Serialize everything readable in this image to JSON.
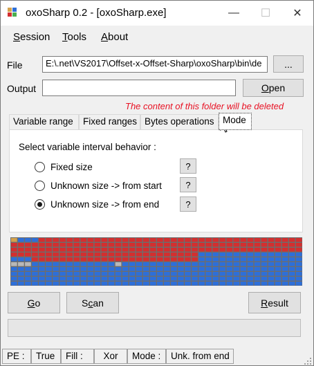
{
  "window": {
    "title": "oxoSharp 0.2 - [oxoSharp.exe]",
    "minimize_glyph": "—",
    "maximize_glyph": "☐",
    "close_glyph": "✕"
  },
  "menu": [
    {
      "u": "S",
      "rest": "ession"
    },
    {
      "u": "T",
      "rest": "ools"
    },
    {
      "u": "A",
      "rest": "bout"
    }
  ],
  "file": {
    "label": "File",
    "value": "E:\\.net\\VS2017\\Offset-x-Offset-Sharp\\oxoSharp\\bin\\de",
    "browse_label": "..."
  },
  "output": {
    "label": "Output",
    "value": "",
    "open_u": "O",
    "open_rest": "pen"
  },
  "warning": "The content of this folder will be deleted",
  "tabs": [
    "Variable range",
    "Fixed ranges",
    "Bytes operations",
    "Mode"
  ],
  "active_tab": 3,
  "mode_panel": {
    "heading": "Select variable interval behavior :",
    "options": [
      {
        "label": "Fixed size",
        "help": "?",
        "selected": false
      },
      {
        "label": "Unknown size -> from start",
        "help": "?",
        "selected": false
      },
      {
        "label": "Unknown size -> from end",
        "help": "?",
        "selected": true
      }
    ]
  },
  "grid": {
    "colors": {
      "orange": "#d4a24c",
      "red": "#d32f2f",
      "blue": "#2e6fd8",
      "gray": "#b8b8b8",
      "bg": "#6d6d6d"
    },
    "cols": 42,
    "rows": [
      "OBBBRRRRRRRRRRRRRRRRRRRRRRRRRRRRRRRRRRRRRR",
      "RRRRRRRRRRRRRRRRRRRRRRRRRRRRRRRRRRRRRRRRRR",
      "RRRRRRRRRRRRRRRRRRRRRRRRRRRRRRRRRRRRRRRRRR",
      "RRRRRRRRRRRRRRRRRRRRRRRRRRRBBBBBBBBBBBBBBB",
      "BBBRRRRRRRRRRRRRRRRRRRRRRRRBBBBBBBBBBBBBBB",
      "GGGBBBBBBBBBBBBGBBBBBBBBBBBBBBBBBBBBBBBBBB",
      "BBBBBBBBBBBBBBBBBBBBBBBBBBBBBBBBBBBBBBBBBB",
      "BBBBBBBBBBBBBBBBBBBBBBBBBBBBBBBBBBBBBBBBBB",
      "BBBBBBBBBBBBBBBBBBBBBBBBBBBBBBBBBBBBBBBBBB",
      "BBBBBBBBBBBBBBBBBBBBBBBBBBBBBBBBBBBBBBBBBB"
    ]
  },
  "buttons": {
    "go_u": "G",
    "go_rest": "o",
    "scan_pre": "S",
    "scan_u": "c",
    "scan_rest": "an",
    "result_u": "R",
    "result_rest": "esult"
  },
  "progress": 0,
  "status": [
    "PE :",
    "True",
    "Fill :",
    "Xor",
    "Mode :",
    "Unk. from end"
  ]
}
